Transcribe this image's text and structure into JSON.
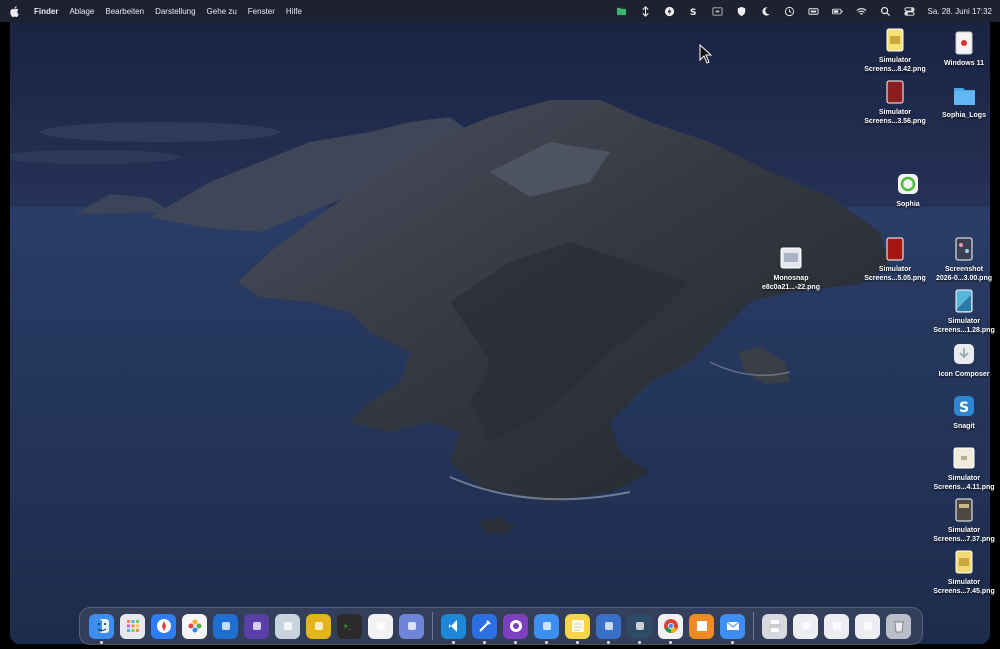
{
  "menubar": {
    "app_name": "Finder",
    "items": [
      "Ablage",
      "Bearbeiten",
      "Darstellung",
      "Gehe zu",
      "Fenster",
      "Hilfe"
    ],
    "status_icons": [
      "folder-green-icon",
      "arrows-icon",
      "bolt-icon",
      "s-app-icon",
      "screen-icon",
      "shield-icon",
      "moon-icon",
      "clock-icon",
      "display-icon",
      "battery-icon",
      "wifi-icon",
      "search-icon",
      "control-center-icon"
    ],
    "clock": "Sa. 28. Juni  17:32"
  },
  "desktop_icons": [
    {
      "label": "Simulator\nScreens...8.42.png",
      "kind": "yellow-doc"
    },
    {
      "label": "Windows 11",
      "kind": "white-doc"
    },
    {
      "label": "Simulator\nScreens...3.56.png",
      "kind": "red-doc"
    },
    {
      "label": "Sophia_Logs",
      "kind": "folder"
    },
    {
      "label": "Sophia",
      "kind": "green-app"
    },
    {
      "label": "Monosnap\ne8c0a21...-22.png",
      "kind": "gray-doc"
    },
    {
      "label": "Simulator\nScreens...5.05.png",
      "kind": "red-doc"
    },
    {
      "label": "Screenshot\n2026-0...3.00.png",
      "kind": "phone-doc"
    },
    {
      "label": "Simulator\nScreens...1.28.png",
      "kind": "blue-doc"
    },
    {
      "label": "Icon Composer",
      "kind": "white-app"
    },
    {
      "label": "Snagit",
      "kind": "snagit-app"
    },
    {
      "label": "Simulator\nScreens...4.11.png",
      "kind": "beige-doc"
    },
    {
      "label": "Simulator\nScreens...7.37.png",
      "kind": "dark-doc"
    },
    {
      "label": "Simulator\nScreens...7.45.png",
      "kind": "yellow-doc"
    }
  ],
  "dock": {
    "apps": [
      {
        "name": "finder-icon",
        "color": "#3b8ef0",
        "running": true
      },
      {
        "name": "launchpad-icon",
        "color": "#e8e8ee",
        "running": false
      },
      {
        "name": "safari-icon",
        "color": "#2f7df5",
        "running": false
      },
      {
        "name": "photos-icon",
        "color": "#f5f5f5",
        "running": false
      },
      {
        "name": "outlook-icon",
        "color": "#1f6fd0",
        "running": false
      },
      {
        "name": "obsidian-icon",
        "color": "#5b3fa8",
        "running": false
      },
      {
        "name": "silverlock-icon",
        "color": "#c9d3de",
        "running": false
      },
      {
        "name": "forklift-icon",
        "color": "#e2b51a",
        "running": false
      },
      {
        "name": "terminal-icon",
        "color": "#2b2b2b",
        "running": false
      },
      {
        "name": "freeform-icon",
        "color": "#f2f2f2",
        "running": false
      },
      {
        "name": "simulator-icon",
        "color": "#6f86d8",
        "running": false
      },
      {
        "name": "vscode-icon",
        "color": "#1e88d8",
        "running": true
      },
      {
        "name": "xcode-icon",
        "color": "#2b6fe0",
        "running": true
      },
      {
        "name": "github-desktop-icon",
        "color": "#7b3fc0",
        "running": true
      },
      {
        "name": "files-icon",
        "color": "#3d8ff0",
        "running": true
      },
      {
        "name": "notes-icon",
        "color": "#f7d44c",
        "running": true
      },
      {
        "name": "database-icon",
        "color": "#3a70c8",
        "running": true
      },
      {
        "name": "stack-icon",
        "color": "#2e4a66",
        "running": true
      },
      {
        "name": "chrome-icon",
        "color": "#f2f2f2",
        "running": true
      },
      {
        "name": "books-icon",
        "color": "#f08a24",
        "running": false
      },
      {
        "name": "mail-icon",
        "color": "#3f8ef3",
        "running": true
      }
    ],
    "right": [
      {
        "name": "printer-icon",
        "color": "#d7d9de"
      },
      {
        "name": "document-stack-1-icon",
        "color": "#eceef2"
      },
      {
        "name": "document-stack-2-icon",
        "color": "#eceef2"
      },
      {
        "name": "document-stack-3-icon",
        "color": "#eceef2"
      },
      {
        "name": "trash-icon",
        "color": "#b9bec8"
      }
    ]
  }
}
